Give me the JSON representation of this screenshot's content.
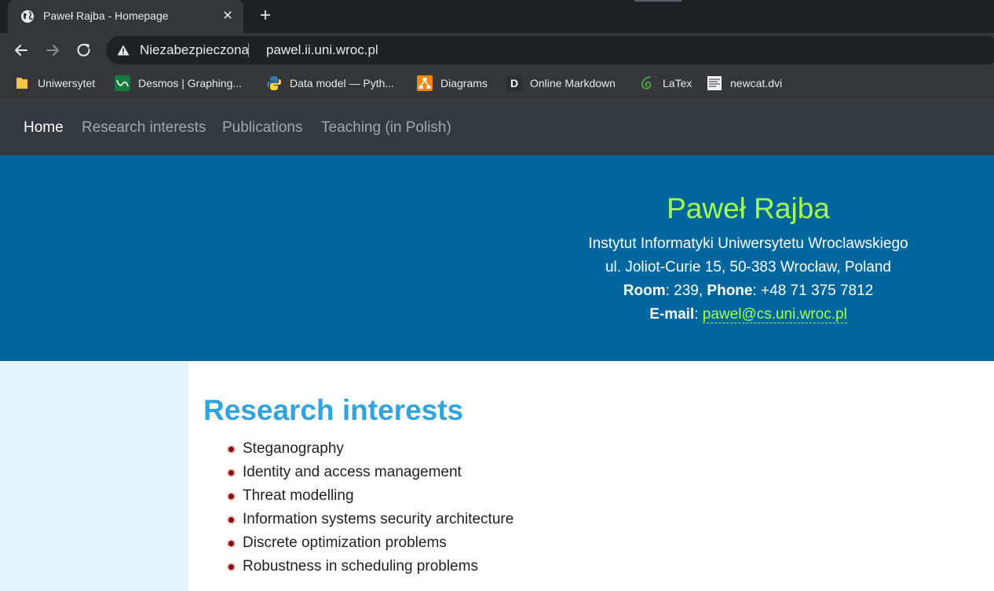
{
  "browser": {
    "tab": {
      "title": "Paweł Rajba - Homepage",
      "icon": "globe-icon"
    },
    "omnibox": {
      "security_label": "Niezabezpieczona",
      "url": "pawel.ii.uni.wroc.pl"
    },
    "bookmarks": [
      {
        "label": "Uniwersytet",
        "icon": "folder-icon"
      },
      {
        "label": "Desmos | Graphing...",
        "icon": "desmos-icon"
      },
      {
        "label": "Data model — Pyth...",
        "icon": "python-icon"
      },
      {
        "label": "Diagrams",
        "icon": "diagrams-icon"
      },
      {
        "label": "Online Markdown",
        "icon": "markdown-icon"
      },
      {
        "label": "LaTex",
        "icon": "overleaf-icon"
      },
      {
        "label": "newcat.dvi",
        "icon": "document-icon"
      }
    ]
  },
  "site_nav": {
    "items": [
      {
        "label": "Home",
        "active": true
      },
      {
        "label": "Research interests",
        "active": false
      },
      {
        "label": "Publications",
        "active": false
      },
      {
        "label": "Teaching (in Polish)",
        "active": false
      }
    ]
  },
  "hero": {
    "name": "Paweł Rajba",
    "institute": "Instytut Informatyki Uniwersytetu Wroclawskiego",
    "address": "ul. Joliot-Curie 15, 50-383 Wrocław, Poland",
    "room_label": "Room",
    "room_value": ": 239, ",
    "phone_label": "Phone",
    "phone_value": ": +48 71 375 7812",
    "email_label": "E-mail",
    "email_sep": ": ",
    "email": "pawel@cs.uni.wroc.pl"
  },
  "research": {
    "title": "Research interests",
    "items": [
      "Steganography",
      "Identity and access management",
      "Threat modelling",
      "Information systems security architecture",
      "Discrete optimization problems",
      "Robustness in scheduling problems"
    ]
  },
  "colors": {
    "hero_bg": "#00669e",
    "hero_name": "#a6ff4d",
    "nav_bg": "#343a40",
    "section_title": "#30a3e0",
    "bullet": "#8b0a0a",
    "left_band": "#e6f4fd"
  }
}
